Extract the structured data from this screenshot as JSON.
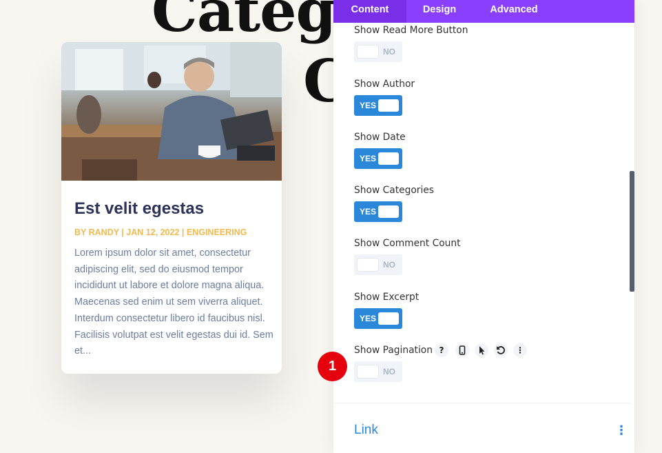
{
  "background": {
    "heading_line1": "Category",
    "heading_line2": "C"
  },
  "card": {
    "title": "Est velit egestas",
    "meta": "BY RANDY | JAN 12, 2022 | ENGINEERING",
    "excerpt": "Lorem ipsum dolor sit amet, consectetur adipiscing elit, sed do eiusmod tempor incididunt ut labore et dolore magna aliqua. Maecenas sed enim ut sem viverra aliquet. Interdum consectetur libero id faucibus nisl. Facilisis volutpat est velit egestas dui id. Sem et..."
  },
  "panel": {
    "tabs": [
      {
        "label": "Content",
        "active": true
      },
      {
        "label": "Design",
        "active": false
      },
      {
        "label": "Advanced",
        "active": false
      }
    ],
    "settings": [
      {
        "label": "Show Read More Button",
        "value": "NO"
      },
      {
        "label": "Show Author",
        "value": "YES"
      },
      {
        "label": "Show Date",
        "value": "YES"
      },
      {
        "label": "Show Categories",
        "value": "YES"
      },
      {
        "label": "Show Comment Count",
        "value": "NO"
      },
      {
        "label": "Show Excerpt",
        "value": "YES"
      },
      {
        "label": "Show Pagination",
        "value": "NO"
      }
    ],
    "pagination_icons": [
      "help-icon",
      "mobile-icon",
      "hover-cursor-icon",
      "reset-icon",
      "more-options-icon"
    ],
    "step_badge": "1",
    "next_section": "Link",
    "colors": {
      "tab_bar": "#8a3ffc",
      "toggle_on": "#2b87da",
      "badge": "#e4000d"
    }
  }
}
